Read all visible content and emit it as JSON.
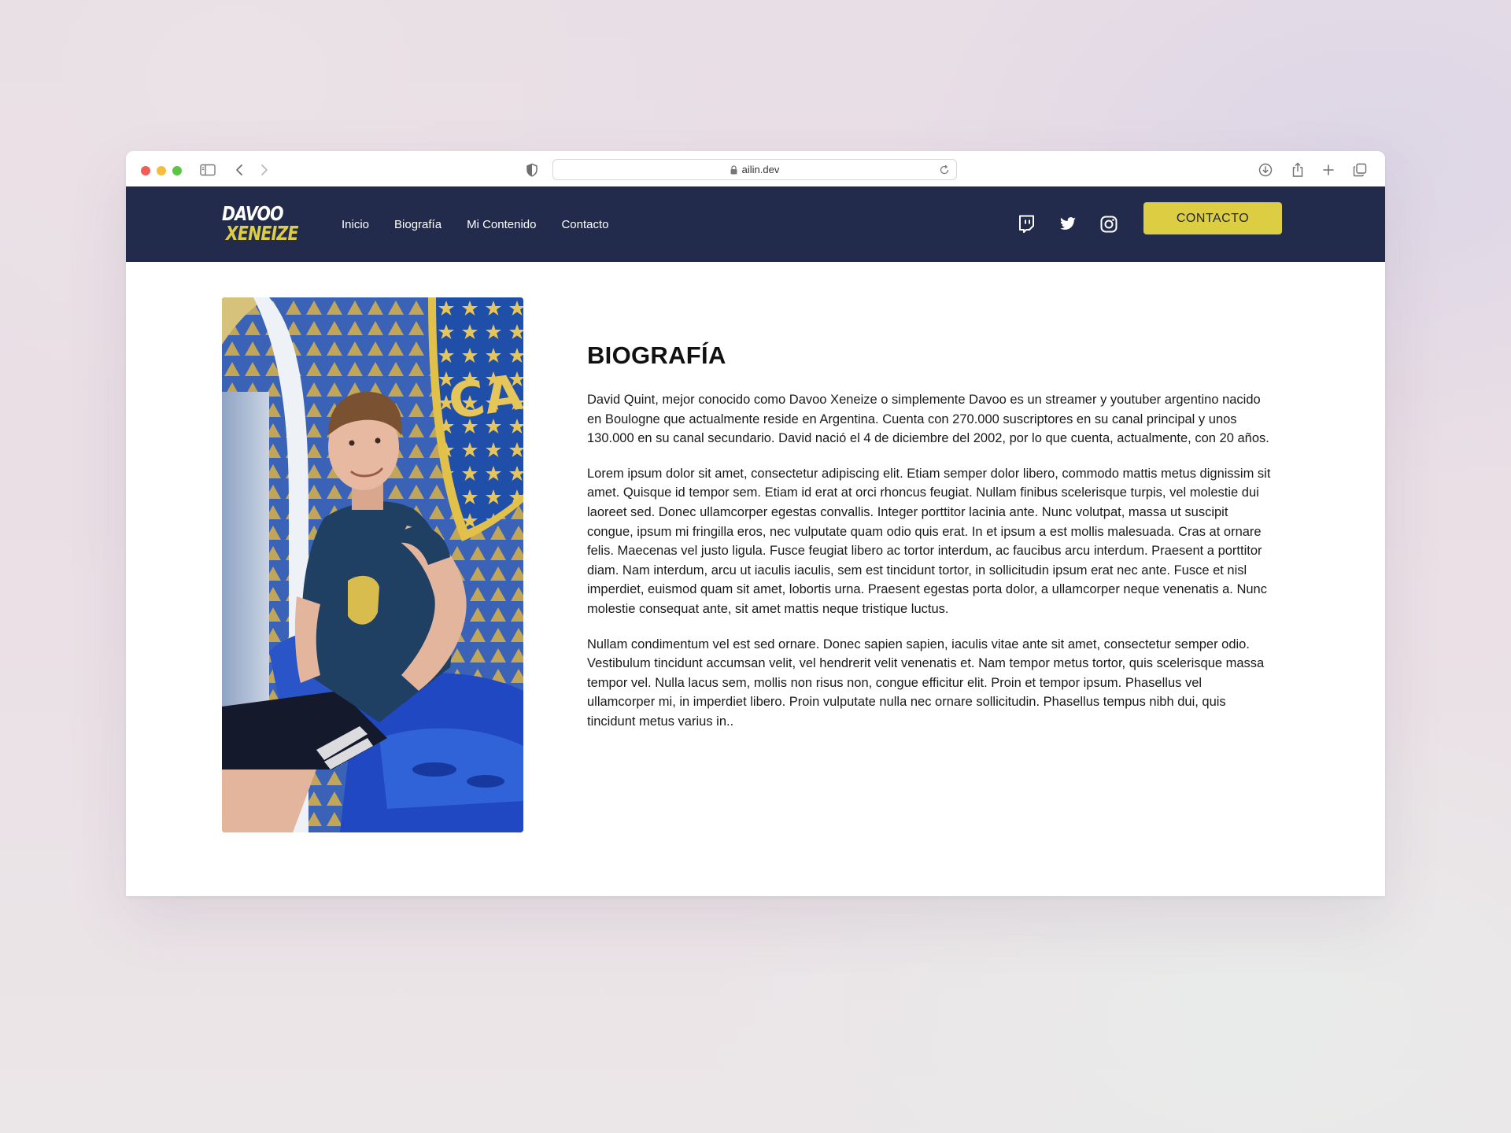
{
  "browser": {
    "url": "ailin.dev",
    "icons": [
      "sidebar-icon",
      "back-icon",
      "forward-icon",
      "shield-icon",
      "lock-icon",
      "reload-icon",
      "download-icon",
      "share-icon",
      "new-tab-icon",
      "tabs-overview-icon"
    ]
  },
  "site": {
    "logo": {
      "line1": "DAVOO",
      "line2": "XENEIZE"
    },
    "nav": [
      {
        "label": "Inicio"
      },
      {
        "label": "Biografía"
      },
      {
        "label": "Mi Contenido"
      },
      {
        "label": "Contacto"
      }
    ],
    "social_icons": [
      "twitch-icon",
      "twitter-icon",
      "instagram-icon"
    ],
    "cta_label": "CONTACTO",
    "colors": {
      "nav_bg": "#222b4c",
      "accent": "#dccd43"
    }
  },
  "bio": {
    "title": "BIOGRAFÍA",
    "paragraphs": [
      "David Quint, mejor conocido como Davoo Xeneize o simplemente Davoo es un streamer y youtuber argentino nacido en Boulogne que actualmente reside en Argentina. Cuenta con 270.000 suscriptores en su canal principal y unos 130.000 en su canal secundario. David nació el 4 de diciembre del 2002, por lo que cuenta, actualmente, con 20 años.",
      "Lorem ipsum dolor sit amet, consectetur adipiscing elit. Etiam semper dolor libero, commodo mattis metus dignissim sit amet. Quisque id tempor sem. Etiam id erat at orci rhoncus feugiat. Nullam finibus scelerisque turpis, vel molestie dui laoreet sed. Donec ullamcorper egestas convallis. Integer porttitor lacinia ante. Nunc volutpat, massa ut suscipit congue, ipsum mi fringilla eros, nec vulputate quam odio quis erat. In et ipsum a est mollis malesuada. Cras at ornare felis. Maecenas vel justo ligula. Fusce feugiat libero ac tortor interdum, ac faucibus arcu interdum. Praesent a porttitor diam. Nam interdum, arcu ut iaculis iaculis, sem est tincidunt tortor, in sollicitudin ipsum erat nec ante. Fusce et nisl imperdiet, euismod quam sit amet, lobortis urna. Praesent egestas porta dolor, a ullamcorper neque venenatis a. Nunc molestie consequat ante, sit amet mattis neque tristique luctus.",
      "Nullam condimentum vel est sed ornare. Donec sapien sapien, iaculis vitae ante sit amet, consectetur semper odio. Vestibulum tincidunt accumsan velit, vel hendrerit velit venenatis et. Nam tempor metus tortor, quis scelerisque massa tempor vel. Nulla lacus sem, mollis non risus non, congue efficitur elit. Proin et tempor ipsum. Phasellus vel ullamcorper mi, in imperdiet libero. Proin vulputate nulla nec ornare sollicitudin. Phasellus tempus nibh dui, quis tincidunt metus varius in.."
    ]
  }
}
